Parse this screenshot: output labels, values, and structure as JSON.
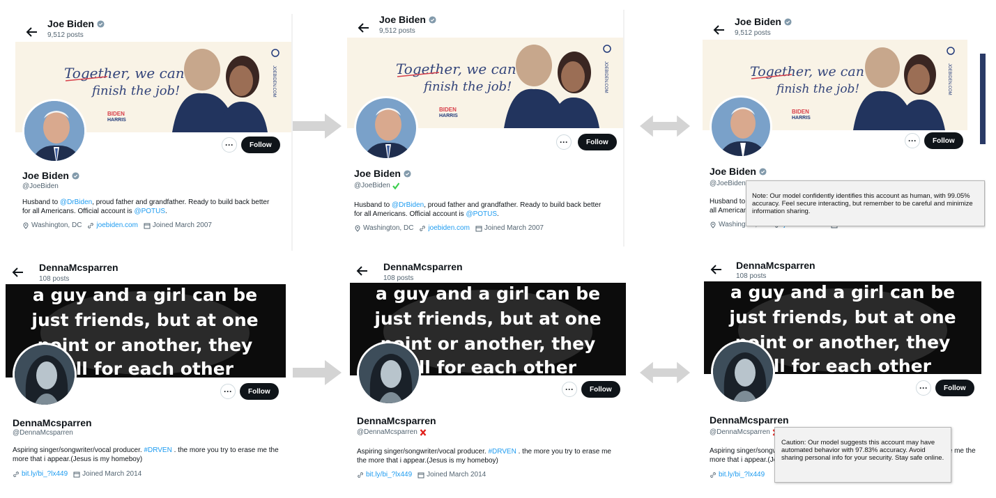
{
  "biden": {
    "top_name": "Joe Biden",
    "posts": "9,512 posts",
    "banner": {
      "slogan_line1": "Together, we can",
      "slogan_line2": "finish the job!",
      "logo_top": "BIDEN",
      "logo_bottom": "HARRIS",
      "vertical_text": "JOEBIDEN.COM"
    },
    "name": "Joe Biden",
    "handle": "@JoeBiden",
    "bio_part1": "Husband to ",
    "bio_link1": "@DrBiden",
    "bio_part2": ", proud father and grandfather. Ready to build back better for all Americans. Official account is ",
    "bio_link2": "@POTUS",
    "bio_part3": ".",
    "location": "Washington, DC",
    "website": "joebiden.com",
    "joined": "Joined March 2007",
    "follow_label": "Follow",
    "more_label": "···",
    "note": "Note: Our model confidently identifies this account as human, with 99.05% accuracy. Feel secure interacting, but remember to be careful and minimize information sharing."
  },
  "denna": {
    "top_name": "DennaMcsparren",
    "posts": "108 posts",
    "banner": {
      "line1": "a guy and a girl can be",
      "line2": "just friends, but at one",
      "line3": "point or another, they",
      "line4": "fall for each other"
    },
    "name": "DennaMcsparren",
    "handle": "@DennaMcsparren",
    "bio_part1": "Aspiring singer/songwriter/vocal producer. ",
    "bio_link1": "#DRVEN",
    "bio_part2": " . the more you try to erase me the more that i appear.(Jesus is my homeboy)",
    "website": "bit.ly/bi_?lx449",
    "joined": "Joined March 2014",
    "follow_label": "Follow",
    "more_label": "···",
    "note": "Caution: Our model suggests this account may have automated behavior with 97.83% accuracy. Avoid sharing personal info for your security. Stay safe online."
  },
  "colors": {
    "verified": "#1d9bf0",
    "human_badge": "#3ccf4e",
    "bot_badge": "#e0201b",
    "link": "#1d9bf0",
    "arrow": "#d4d4d4"
  }
}
